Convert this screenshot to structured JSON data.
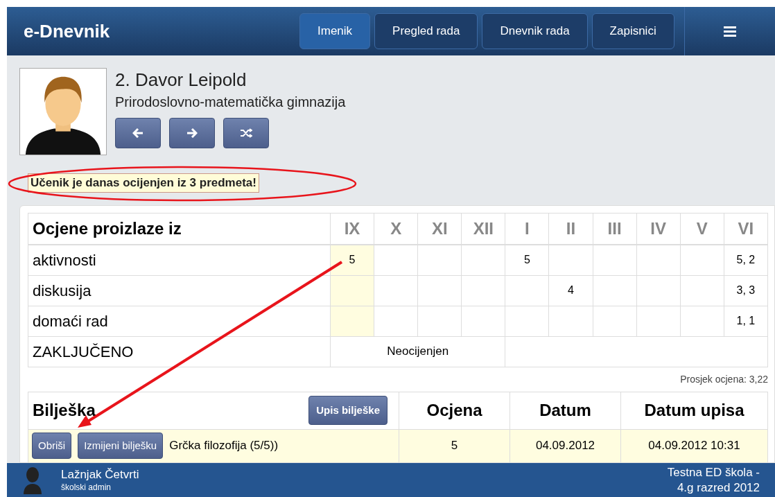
{
  "app": {
    "title": "e-Dnevnik"
  },
  "nav": [
    {
      "label": "Imenik",
      "selected": true
    },
    {
      "label": "Pregled rada",
      "selected": false
    },
    {
      "label": "Dnevnik rada",
      "selected": false
    },
    {
      "label": "Zapisnici",
      "selected": false
    }
  ],
  "student": {
    "name": "2. Davor Leipold",
    "school": "Prirodoslovno-matematička gimnazija"
  },
  "alert": "Učenik je danas ocijenjen iz 3 predmeta!",
  "grades_table": {
    "heading": "Ocjene proizlaze iz",
    "months": [
      {
        "label": "IX",
        "highlighted": true
      },
      {
        "label": "X",
        "highlighted": false
      },
      {
        "label": "XI",
        "highlighted": false
      },
      {
        "label": "XII",
        "highlighted": false
      },
      {
        "label": "I",
        "highlighted": false
      },
      {
        "label": "II",
        "highlighted": false
      },
      {
        "label": "III",
        "highlighted": false
      },
      {
        "label": "IV",
        "highlighted": false
      },
      {
        "label": "V",
        "highlighted": false
      },
      {
        "label": "VI",
        "highlighted": false
      }
    ],
    "rows": [
      {
        "label": "aktivnosti",
        "cells": [
          "5",
          null,
          null,
          null,
          "5",
          null,
          null,
          null,
          null,
          "5, 2"
        ]
      },
      {
        "label": "diskusija",
        "cells": [
          null,
          null,
          null,
          null,
          null,
          "4",
          null,
          null,
          null,
          "3, 3"
        ]
      },
      {
        "label": "domaći rad",
        "cells": [
          null,
          null,
          null,
          null,
          null,
          null,
          null,
          null,
          null,
          "1, 1"
        ]
      }
    ],
    "final_row": {
      "label": "ZAKLJUČENO",
      "value": "Neocijenjen"
    }
  },
  "average": "Prosjek ocjena: 3,22",
  "notes_table": {
    "columns": [
      "Bilješka",
      "Ocjena",
      "Datum",
      "Datum upisa"
    ],
    "add_button": "Upis bilješke",
    "rows": [
      {
        "delete_button": "Obriši",
        "edit_button": "Izmijeni bilješku",
        "note": "Grčka filozofija (5/5))",
        "grade": "5",
        "date": "04.09.2012",
        "entry_date": "04.09.2012 10:31"
      }
    ]
  },
  "footer": {
    "user": "Lažnjak Četvrti",
    "role": "školski admin",
    "school": "Testna ED škola -",
    "class": "4.g razred 2012"
  }
}
